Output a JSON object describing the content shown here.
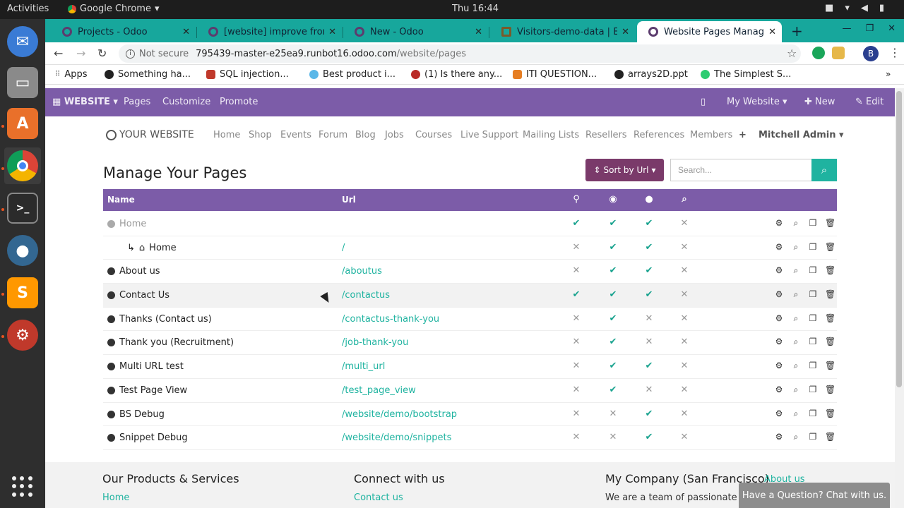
{
  "os": {
    "activities": "Activities",
    "app_name": "Google Chrome",
    "clock": "Thu 16:44",
    "sys_icons": [
      "video-icon",
      "wifi-icon",
      "volume-icon",
      "battery-icon"
    ]
  },
  "chrome": {
    "tabs": [
      {
        "title": "Projects - Odoo"
      },
      {
        "title": "[website] improve from"
      },
      {
        "title": "New - Odoo"
      },
      {
        "title": "Visitors-demo-data | E"
      },
      {
        "title": "Website Pages Manag"
      }
    ],
    "address": {
      "security": "Not secure",
      "host": "795439-master-e25ea9.runbot16.odoo.com",
      "path": "/website/pages"
    },
    "avatar_letter": "B",
    "bookmarks": [
      "Apps",
      "Something ha...",
      "SQL injection...",
      "Best product i...",
      "(1) Is there any...",
      "ITI QUESTION...",
      "arrays2D.ppt",
      "The Simplest S..."
    ]
  },
  "odoo": {
    "menu": {
      "brand": "WEBSITE",
      "pages": "Pages",
      "customize": "Customize",
      "promote": "Promote",
      "my_website": "My Website",
      "new": "New",
      "edit": "Edit"
    },
    "site_nav": {
      "logo": "YOUR WEBSITE",
      "items": [
        "Home",
        "Shop",
        "Events",
        "Forum",
        "Blog",
        "Jobs",
        "Courses",
        "Live Support",
        "Mailing Lists",
        "Resellers",
        "References",
        "Members"
      ],
      "plus": "+",
      "user": "Mitchell Admin"
    },
    "page": {
      "title": "Manage Your Pages",
      "sort_label": "Sort by Url",
      "search_placeholder": "Search..."
    },
    "table": {
      "headers": {
        "name": "Name",
        "url": "Url"
      },
      "rows": [
        {
          "name": "Home",
          "url": "",
          "cols": [
            true,
            true,
            true,
            false
          ],
          "muted": true
        },
        {
          "name": "Home",
          "url": "/",
          "cols": [
            false,
            true,
            true,
            false
          ],
          "child": true
        },
        {
          "name": "About us",
          "url": "/aboutus",
          "cols": [
            false,
            true,
            true,
            false
          ]
        },
        {
          "name": "Contact Us",
          "url": "/contactus",
          "cols": [
            true,
            true,
            true,
            false
          ],
          "highlight": true
        },
        {
          "name": "Thanks (Contact us)",
          "url": "/contactus-thank-you",
          "cols": [
            false,
            true,
            false,
            false
          ]
        },
        {
          "name": "Thank you (Recruitment)",
          "url": "/job-thank-you",
          "cols": [
            false,
            true,
            false,
            false
          ]
        },
        {
          "name": "Multi URL test",
          "url": "/multi_url",
          "cols": [
            false,
            true,
            true,
            false
          ]
        },
        {
          "name": "Test Page View",
          "url": "/test_page_view",
          "cols": [
            false,
            true,
            false,
            false
          ]
        },
        {
          "name": "BS Debug",
          "url": "/website/demo/bootstrap",
          "cols": [
            false,
            false,
            true,
            false
          ]
        },
        {
          "name": "Snippet Debug",
          "url": "/website/demo/snippets",
          "cols": [
            false,
            false,
            true,
            false
          ]
        }
      ]
    },
    "footer": {
      "col1_title": "Our Products & Services",
      "col1_link": "Home",
      "col2_title": "Connect with us",
      "col2_link": "Contact us",
      "col3_title": "My Company (San Francisco)",
      "col3_link": "About us",
      "col3_text": "We are a team of passionate pe"
    },
    "chat": "Have a Question? Chat with us."
  }
}
